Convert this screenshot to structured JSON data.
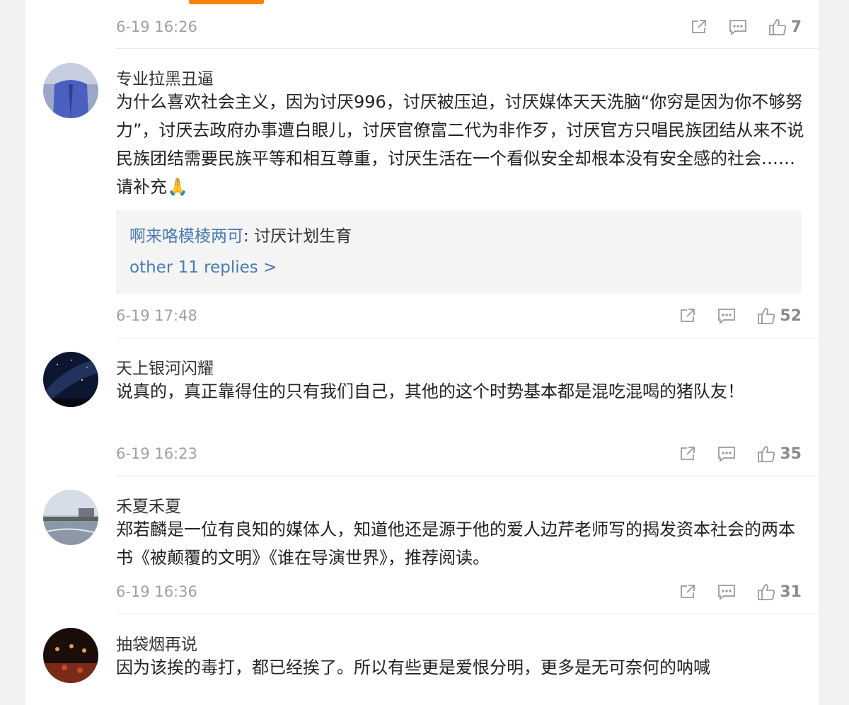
{
  "top_timestamp": "6-19 16:26",
  "top_like_count": "7",
  "comments": [
    {
      "username": "专业拉黑丑逼",
      "content": "为什么喜欢社会主义，因为讨厌996，讨厌被压迫，讨厌媒体天天洗脑“你穷是因为你不够努力”，讨厌去政府办事遭白眼儿，讨厌官僚富二代为非作歹，讨厌官方只唱民族团结从来不说民族团结需要民族平等和相互尊重，讨厌生活在一个看似安全却根本没有安全感的社会……请补充🙏",
      "reply": {
        "user": "啊来咯模棱两可",
        "separator": ": ",
        "text": "讨厌计划生育",
        "more": "other 11 replies >"
      },
      "timestamp": "6-19 17:48",
      "likes": "52"
    },
    {
      "username": "天上银河闪耀",
      "content": "说真的，真正靠得住的只有我们自己，其他的这个时势基本都是混吃混喝的猪队友！",
      "timestamp": "6-19 16:23",
      "likes": "35"
    },
    {
      "username": "禾夏禾夏",
      "content": "郑若麟是一位有良知的媒体人，知道他还是源于他的爱人边芹老师写的揭发资本社会的两本书《被颠覆的文明》《谁在导演世界》，推荐阅读。",
      "timestamp": "6-19 16:36",
      "likes": "31"
    },
    {
      "username": "抽袋烟再说",
      "content": "因为该挨的毒打，都已经挨了。所以有些更是爱恨分明，更多是无可奈何的呐喊"
    }
  ],
  "icons": {
    "share": "share-icon",
    "comment": "comment-icon",
    "like": "thumbs-up-icon"
  },
  "colors": {
    "accent": "#ff8200",
    "link": "#4a7ab2",
    "meta_text": "#a0a0a0"
  }
}
